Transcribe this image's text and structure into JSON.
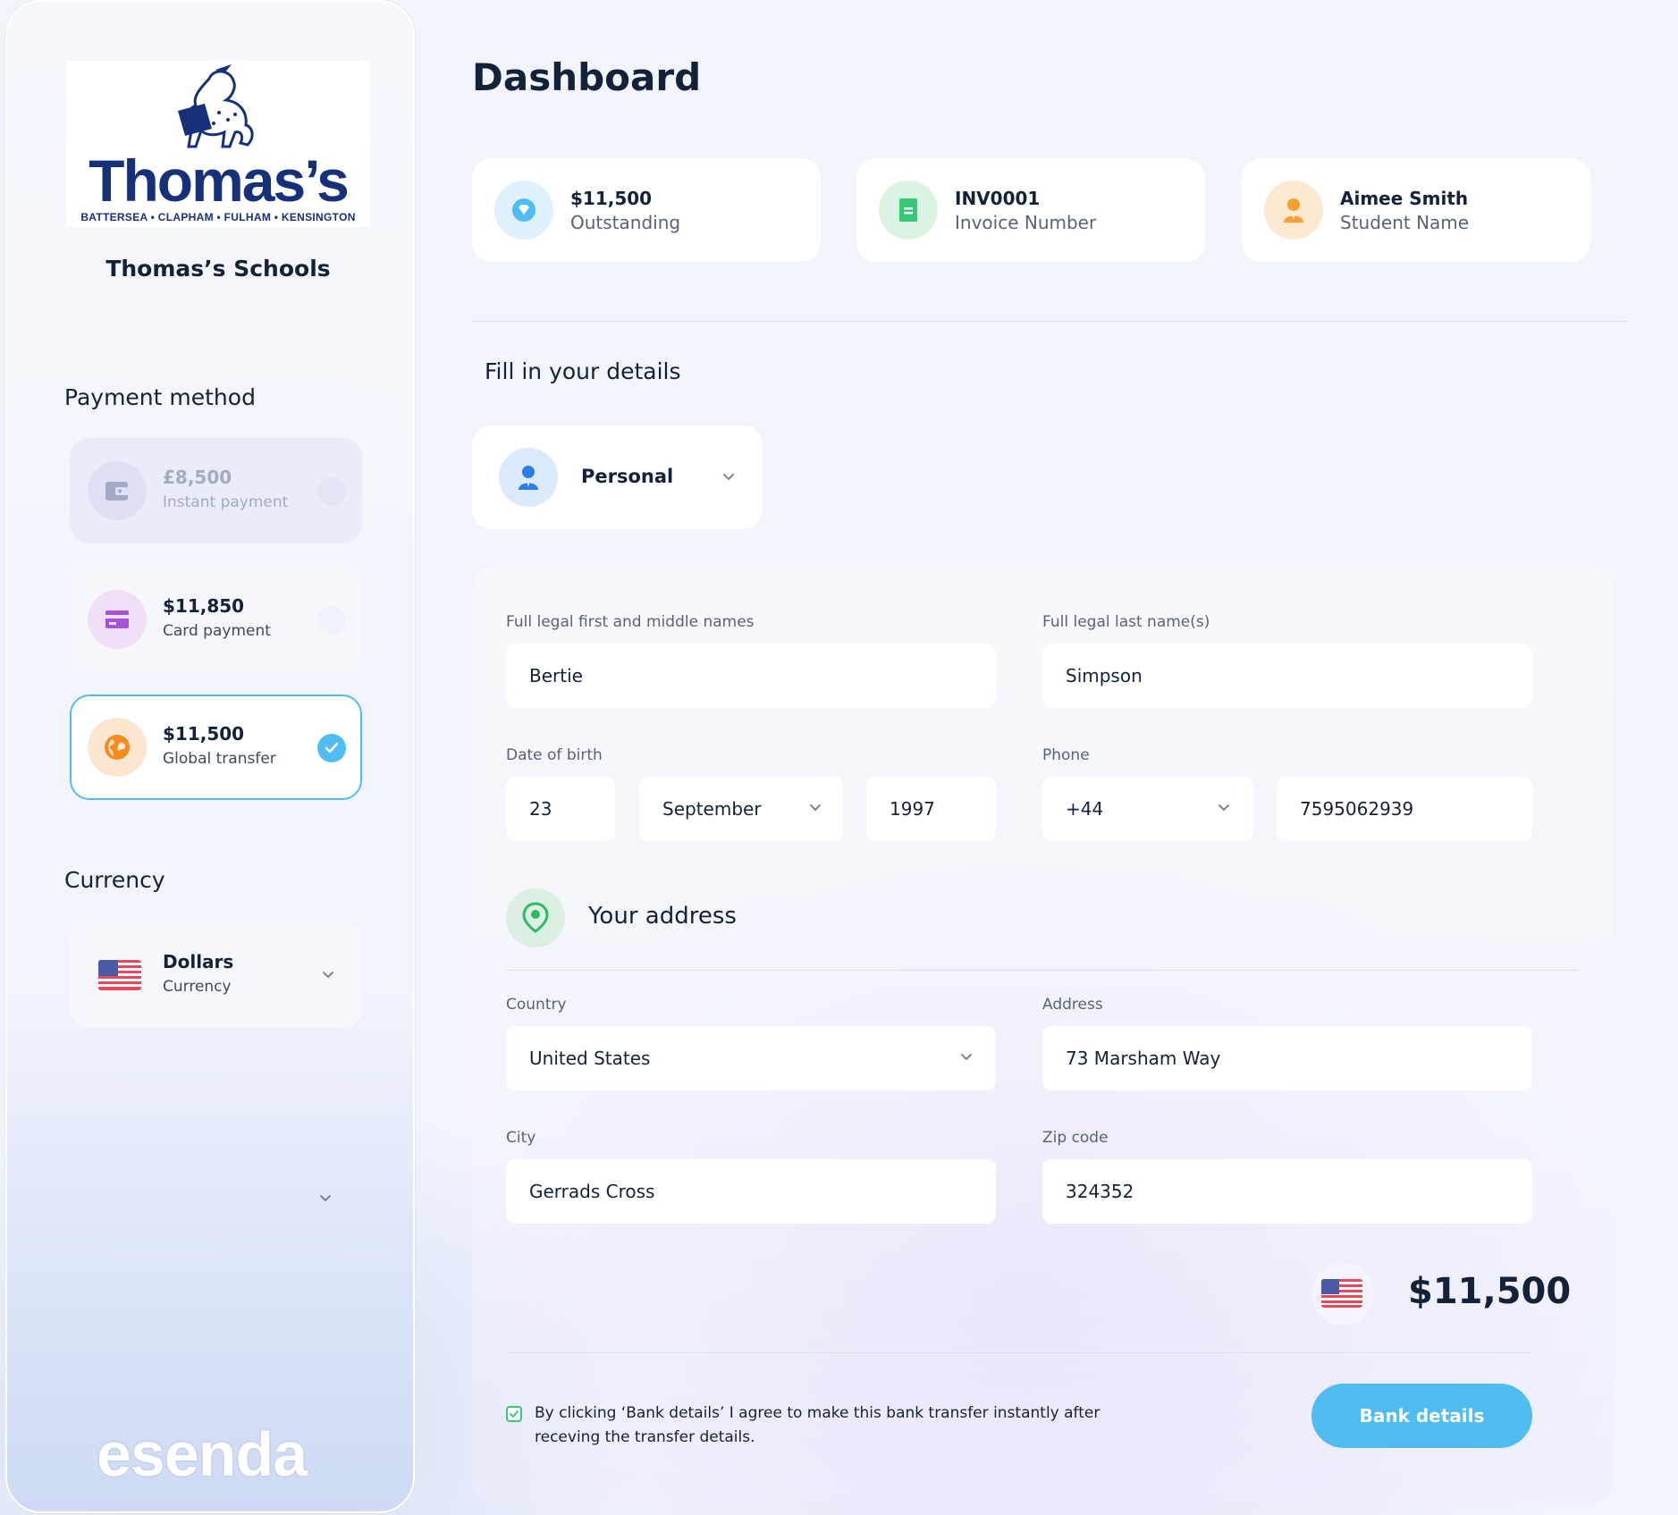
{
  "sidebar": {
    "logo": {
      "wordmark": "Thomas’s",
      "tagline": "BATTERSEA • CLAPHAM • FULHAM • KENSINGTON"
    },
    "school_name": "Thomas’s Schools",
    "payment_method_title": "Payment method",
    "payment_methods": [
      {
        "amount": "£8,500",
        "label": "Instant payment",
        "state": "disabled",
        "icon": "wallet-icon"
      },
      {
        "amount": "$11,850",
        "label": "Card payment",
        "state": "unselected",
        "icon": "card-icon"
      },
      {
        "amount": "$11,500",
        "label": "Global transfer",
        "state": "selected",
        "icon": "globe-icon"
      }
    ],
    "currency_title": "Currency",
    "currency": {
      "value": "Dollars",
      "label": "Currency",
      "flag": "us-flag-icon"
    },
    "brand": "esenda"
  },
  "main": {
    "title": "Dashboard",
    "stats": [
      {
        "value": "$11,500",
        "label": "Outstanding",
        "icon": "diamond-icon",
        "color": "#4fbdf1"
      },
      {
        "value": "INV0001",
        "label": "Invoice Number",
        "icon": "document-icon",
        "color": "#38c878"
      },
      {
        "value": "Aimee Smith",
        "label": "Student Name",
        "icon": "user-icon",
        "color": "#f5a030"
      }
    ],
    "fill_title": "Fill in your details",
    "account_type": "Personal",
    "form": {
      "first_names_label": "Full legal first and middle names",
      "first_names": "Bertie",
      "last_name_label": "Full legal last name(s)",
      "last_name": "Simpson",
      "dob_label": "Date of birth",
      "dob_day": "23",
      "dob_month": "September",
      "dob_year": "1997",
      "phone_label": "Phone",
      "phone_code": "+44",
      "phone_number": "7595062939"
    },
    "address": {
      "title": "Your  address",
      "country_label": "Country",
      "country": "United States",
      "address_label": "Address",
      "address": "73 Marsham Way",
      "city_label": "City",
      "city": "Gerrads Cross",
      "zip_label": "Zip code",
      "zip": "324352"
    },
    "total": "$11,500",
    "agreement": "By clicking ‘Bank details’ I agree to make this bank transfer instantly after receving the transfer details.",
    "bank_button": "Bank details"
  },
  "colors": {
    "accent": "#4fbdf1",
    "navy": "#132238",
    "brand_blue": "#16307a",
    "green": "#38c878",
    "orange": "#f5a030",
    "purple": "#a653d8"
  }
}
